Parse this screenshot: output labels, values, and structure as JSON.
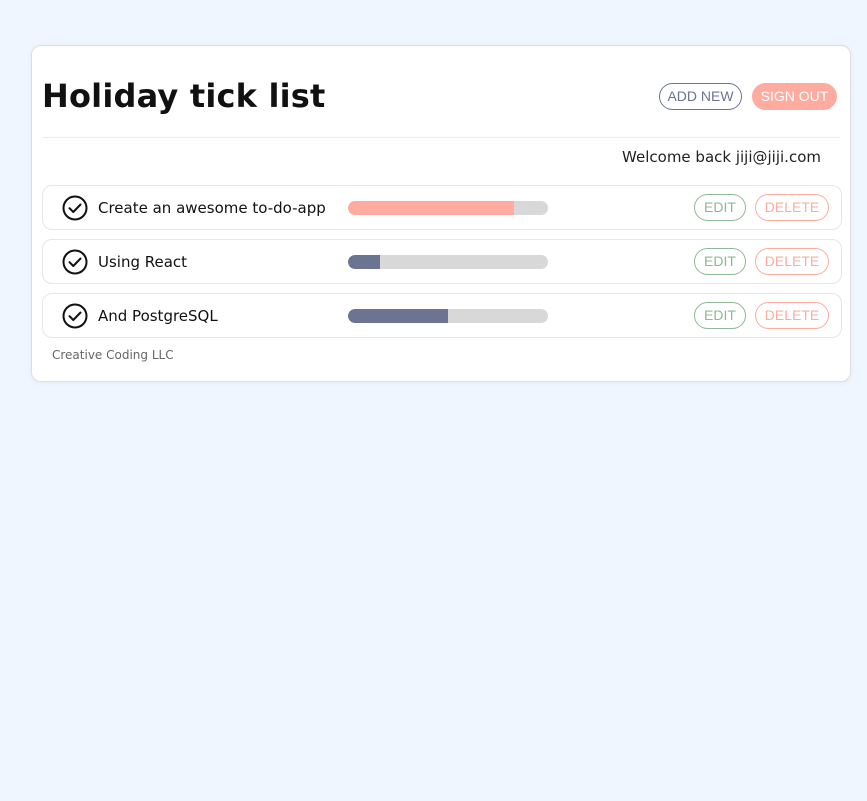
{
  "header": {
    "title": "Holiday tick list",
    "add_new_label": "ADD NEW",
    "sign_out_label": "SIGN OUT"
  },
  "welcome_text": "Welcome back jiji@jiji.com",
  "todos": [
    {
      "title": "Create an awesome to-do-app",
      "progress": 0.83,
      "color": "#ffaba0",
      "edit_label": "EDIT",
      "delete_label": "DELETE"
    },
    {
      "title": "Using React",
      "progress": 0.16,
      "color": "#6d7491",
      "edit_label": "EDIT",
      "delete_label": "DELETE"
    },
    {
      "title": "And PostgreSQL",
      "progress": 0.5,
      "color": "#6d7491",
      "edit_label": "EDIT",
      "delete_label": "DELETE"
    }
  ],
  "footer": "Creative Coding LLC",
  "colors": {
    "background": "#eff6ff",
    "accent_salmon": "#ffaba0",
    "accent_slate": "#6d7491",
    "edit_green": "#8fb994"
  },
  "icons": {
    "item_status": "check-circle-icon"
  }
}
